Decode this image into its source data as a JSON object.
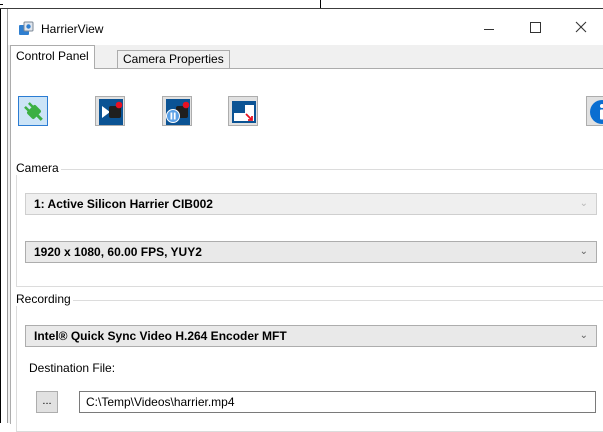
{
  "window": {
    "title": "HarrierView",
    "icon": "app-icon",
    "controls": {
      "minimize_glyph": "",
      "maximize_glyph": "",
      "close_glyph": "✕"
    }
  },
  "tabs": [
    {
      "label": "Control Panel",
      "active": true
    },
    {
      "label": "Camera Properties",
      "active": false
    }
  ],
  "toolbar": {
    "buttons": [
      {
        "name": "connect",
        "icon": "connect-plug-icon",
        "active": true
      },
      {
        "name": "record",
        "icon": "record-camera-icon"
      },
      {
        "name": "pause-record",
        "icon": "pause-camera-icon"
      },
      {
        "name": "window",
        "icon": "window-resize-icon"
      },
      {
        "name": "info",
        "icon": "info-icon"
      }
    ]
  },
  "camera": {
    "group_label": "Camera",
    "device_selected": "1: Active Silicon Harrier CIB002",
    "format_selected": "1920 x 1080, 60.00 FPS, YUY2",
    "chevron": "⌄"
  },
  "recording": {
    "group_label": "Recording",
    "encoder_selected": "Intel® Quick Sync Video H.264 Encoder MFT",
    "destination_label": "Destination File:",
    "browse_label": "...",
    "destination_value": "C:\\Temp\\Videos\\harrier.mp4"
  },
  "colors": {
    "accent_blue": "#0a6ed1",
    "record_red": "#e81123",
    "connect_green": "#3cb043"
  }
}
